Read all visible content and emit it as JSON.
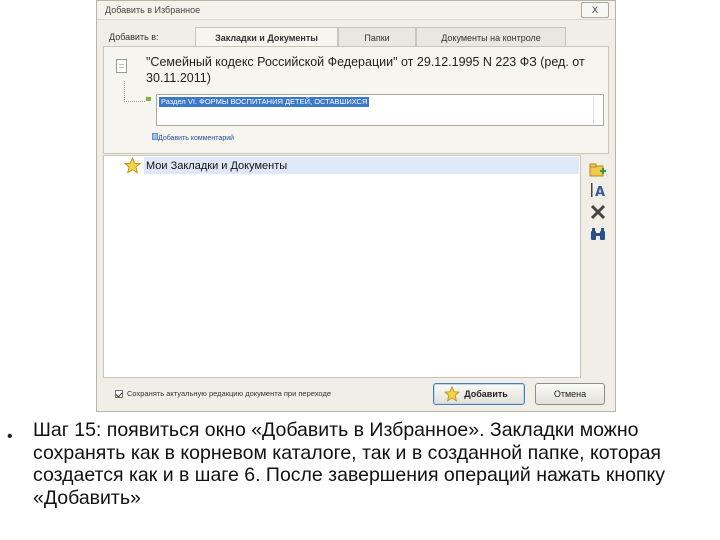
{
  "dialog": {
    "title": "Добавить в Избранное",
    "close_label": "Х",
    "tab_label": "Добавить в:",
    "tabs": [
      {
        "label": "Закладки и Документы",
        "active": true
      },
      {
        "label": "Папки",
        "active": false
      },
      {
        "label": "Документы на контроле",
        "active": false
      }
    ],
    "document": {
      "title": "\"Семейный кодекс Российской Федерации\" от 29.12.1995 N 223 ФЗ (ред. от 30.11.2011)",
      "section": "Раздел VI. ФОРМЫ ВОСПИТАНИЯ ДЕТЕЙ, ОСТАВШИХСЯ",
      "add_comment": "Добавить комментарий"
    },
    "tree": {
      "root_label": "Мои Закладки и Документы",
      "root_icon": "star-icon"
    },
    "tools": [
      "add-folder-icon",
      "rename-icon",
      "delete-icon",
      "find-icon"
    ],
    "save_checkbox_label": "Сохранять актуальную редакцию документа при переходе",
    "save_checked": true,
    "add_button": "Добавить",
    "cancel_button": "Отмена"
  },
  "caption": {
    "bullet": "•",
    "text": "Шаг 15: появиться окно «Добавить в Избранное». Закладки можно сохранять как в корневом каталоге, так и в созданной папке, которая создается как и в шаге 6. После завершения операций нажать кнопку «Добавить»"
  }
}
